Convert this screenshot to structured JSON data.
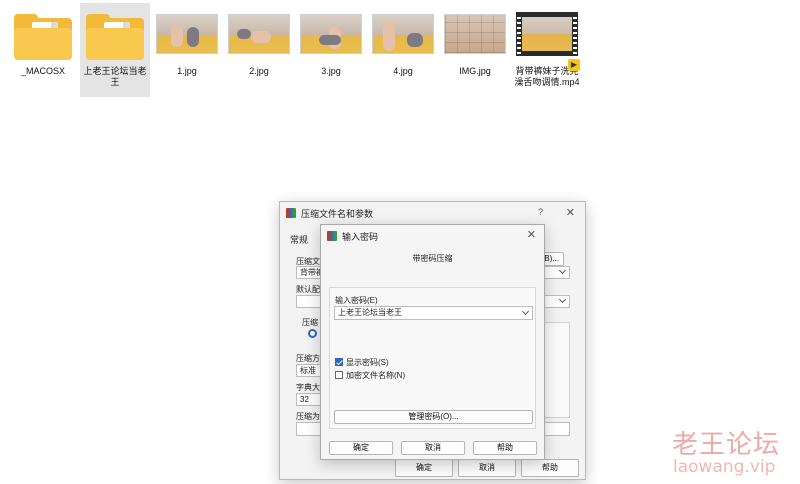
{
  "explorer": {
    "files": [
      {
        "name": "_MACOSX",
        "kind": "folder",
        "selected": false
      },
      {
        "name": "上老王论坛当老王",
        "kind": "folder",
        "selected": true
      },
      {
        "name": "1.jpg",
        "kind": "image",
        "selected": false
      },
      {
        "name": "2.jpg",
        "kind": "image",
        "selected": false
      },
      {
        "name": "3.jpg",
        "kind": "image",
        "selected": false
      },
      {
        "name": "4.jpg",
        "kind": "image",
        "selected": false
      },
      {
        "name": "IMG.jpg",
        "kind": "image",
        "selected": false
      },
      {
        "name": "背带裤妹子洗完澡舌吻调情.mp4",
        "kind": "video",
        "selected": false
      }
    ]
  },
  "back_dialog": {
    "title": "压缩文件名和参数",
    "help": "?",
    "close": "✕",
    "tab_general": "常规",
    "archive_name_label": "压缩文",
    "archive_name_value": "背带裤",
    "browse_tail": "B)...",
    "default_profile_label": "默认配",
    "format_label": "压缩",
    "method_label": "压缩方",
    "method_value": "标准",
    "dict_label": "字典大",
    "dict_value": "32",
    "split_label": "压缩为",
    "ok": "确定",
    "cancel": "取消",
    "help_button": "帮助"
  },
  "front_dialog": {
    "title": "输入密码",
    "close": "✕",
    "heading": "带密码压缩",
    "password_label": "输入密码(E)",
    "password_value": "上老王论坛当老王",
    "show_password": {
      "label": "显示密码(S)",
      "checked": true
    },
    "encrypt_names": {
      "label": "加密文件名称(N)",
      "checked": false
    },
    "manage_button": "管理密码(O)...",
    "ok": "确定",
    "cancel": "取消",
    "help": "帮助"
  },
  "watermark": {
    "line1": "老王论坛",
    "line2": "laowang.vip"
  },
  "colors": {
    "folder": "#f2b93b",
    "checkbox_on": "#2d67c4",
    "watermark": "#f0a8a8"
  }
}
